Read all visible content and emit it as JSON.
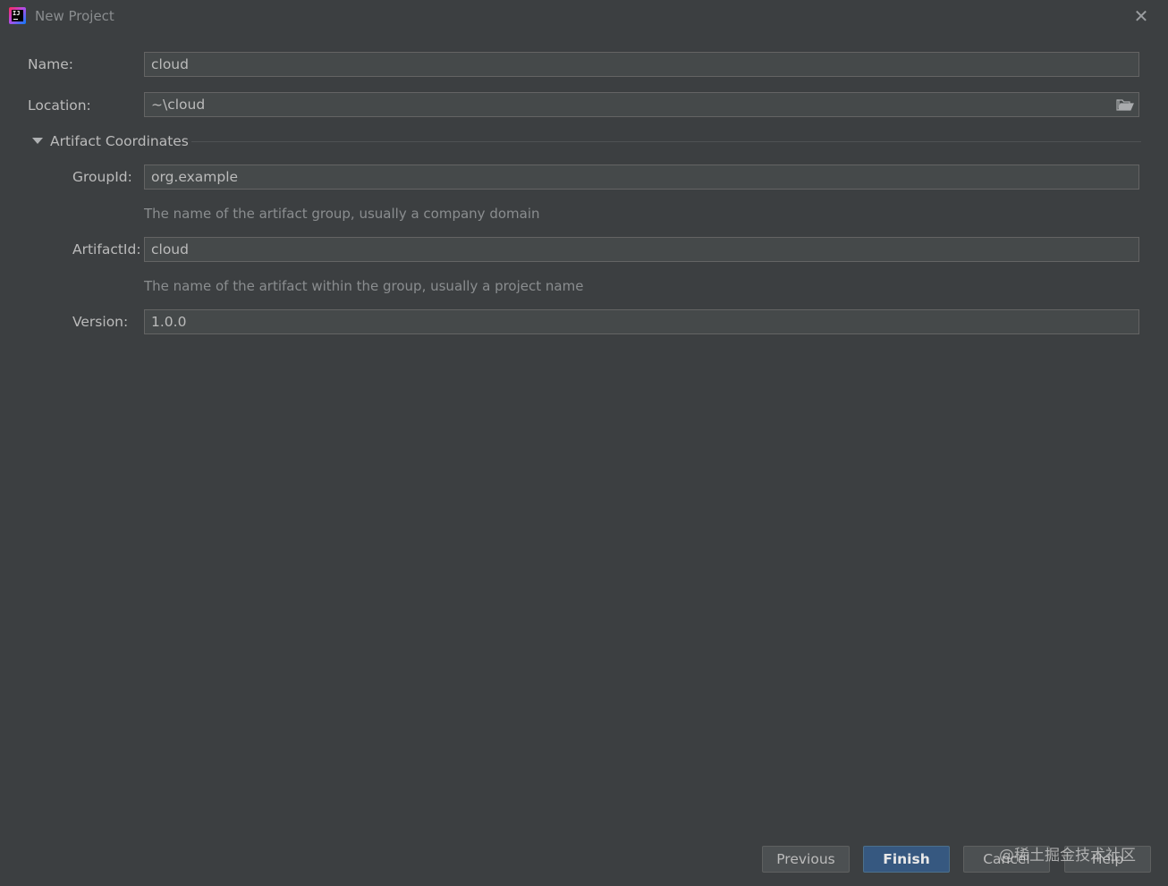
{
  "window": {
    "title": "New Project",
    "close_glyph": "✕",
    "icon": "intellij-idea-icon",
    "icon_text": "IJ"
  },
  "form": {
    "name": {
      "label": "Name:",
      "value": "cloud"
    },
    "location": {
      "label": "Location:",
      "value": "~\\cloud",
      "browse_icon": "folder-icon"
    },
    "section": {
      "label": "Artifact Coordinates",
      "expanded": true
    },
    "group_id": {
      "label": "GroupId:",
      "value": "org.example",
      "hint": "The name of the artifact group, usually a company domain"
    },
    "artifact_id": {
      "label": "ArtifactId:",
      "value": "cloud",
      "hint": "The name of the artifact within the group, usually a project name"
    },
    "version": {
      "label": "Version:",
      "value": "1.0.0"
    }
  },
  "buttons": {
    "previous": "Previous",
    "finish": "Finish",
    "cancel": "Cancel",
    "help": "Help"
  },
  "watermark": "@稀土掘金技术社区",
  "colors": {
    "background": "#3c3f41",
    "field_background": "#45494a",
    "primary_button": "#365880"
  }
}
